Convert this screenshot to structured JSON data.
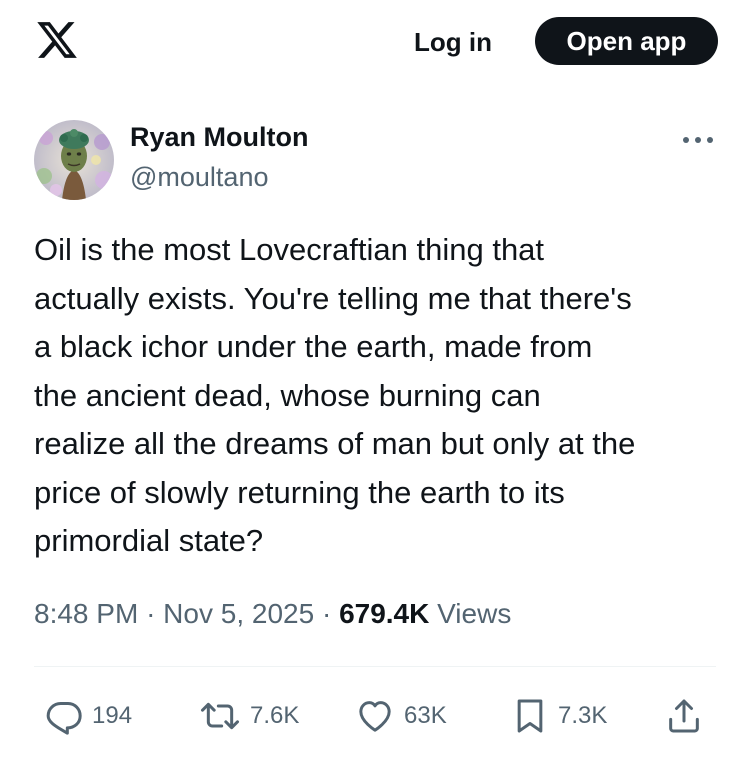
{
  "header": {
    "logo_icon": "x-logo-icon",
    "login_label": "Log in",
    "open_app_label": "Open app"
  },
  "post": {
    "author_name": "Ryan Moulton",
    "author_handle": "@moultano",
    "avatar_icon": "avatar-image",
    "more_icon": "more-options-icon",
    "text": "Oil is the most Lovecraftian thing that\nactually exists. You're telling me that there's\na black ichor under the earth, made from\nthe ancient dead, whose burning can\nrealize all the dreams of man but only at the\nprice of slowly returning the earth to its\nprimordial state?",
    "time": "8:48 PM",
    "separator": "·",
    "date": "Nov 5, 2025",
    "views_count": "679.4K",
    "views_label": "Views"
  },
  "actions": {
    "reply": {
      "icon": "reply-icon",
      "count": "194"
    },
    "repost": {
      "icon": "repost-icon",
      "count": "7.6K"
    },
    "like": {
      "icon": "heart-icon",
      "count": "63K"
    },
    "bookmark": {
      "icon": "bookmark-icon",
      "count": "7.3K"
    },
    "share": {
      "icon": "share-icon"
    }
  },
  "colors": {
    "text_primary": "#0f1419",
    "text_secondary": "#536471",
    "button_dark": "#0f1419",
    "divider": "#eff3f4"
  }
}
